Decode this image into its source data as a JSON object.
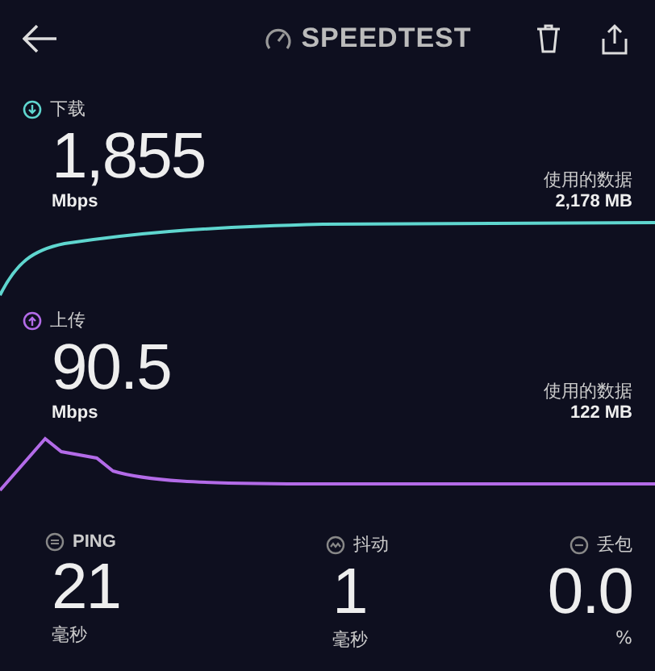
{
  "header": {
    "title": "SPEEDTEST"
  },
  "tests": [
    {
      "kind": "download",
      "label": "下载",
      "value": "1,855",
      "unit": "Mbps",
      "data_label": "使用的数据",
      "data_value": "2,178 MB"
    },
    {
      "kind": "upload",
      "label": "上传",
      "value": "90.5",
      "unit": "Mbps",
      "data_label": "使用的数据",
      "data_value": "122 MB"
    }
  ],
  "stats": [
    {
      "kind": "ping",
      "label": "PING",
      "value": "21",
      "unit": "毫秒"
    },
    {
      "kind": "jitter",
      "label": "抖动",
      "value": "1",
      "unit": "毫秒"
    },
    {
      "kind": "loss",
      "label": "丢包",
      "value": "0.0",
      "unit": "%"
    }
  ]
}
